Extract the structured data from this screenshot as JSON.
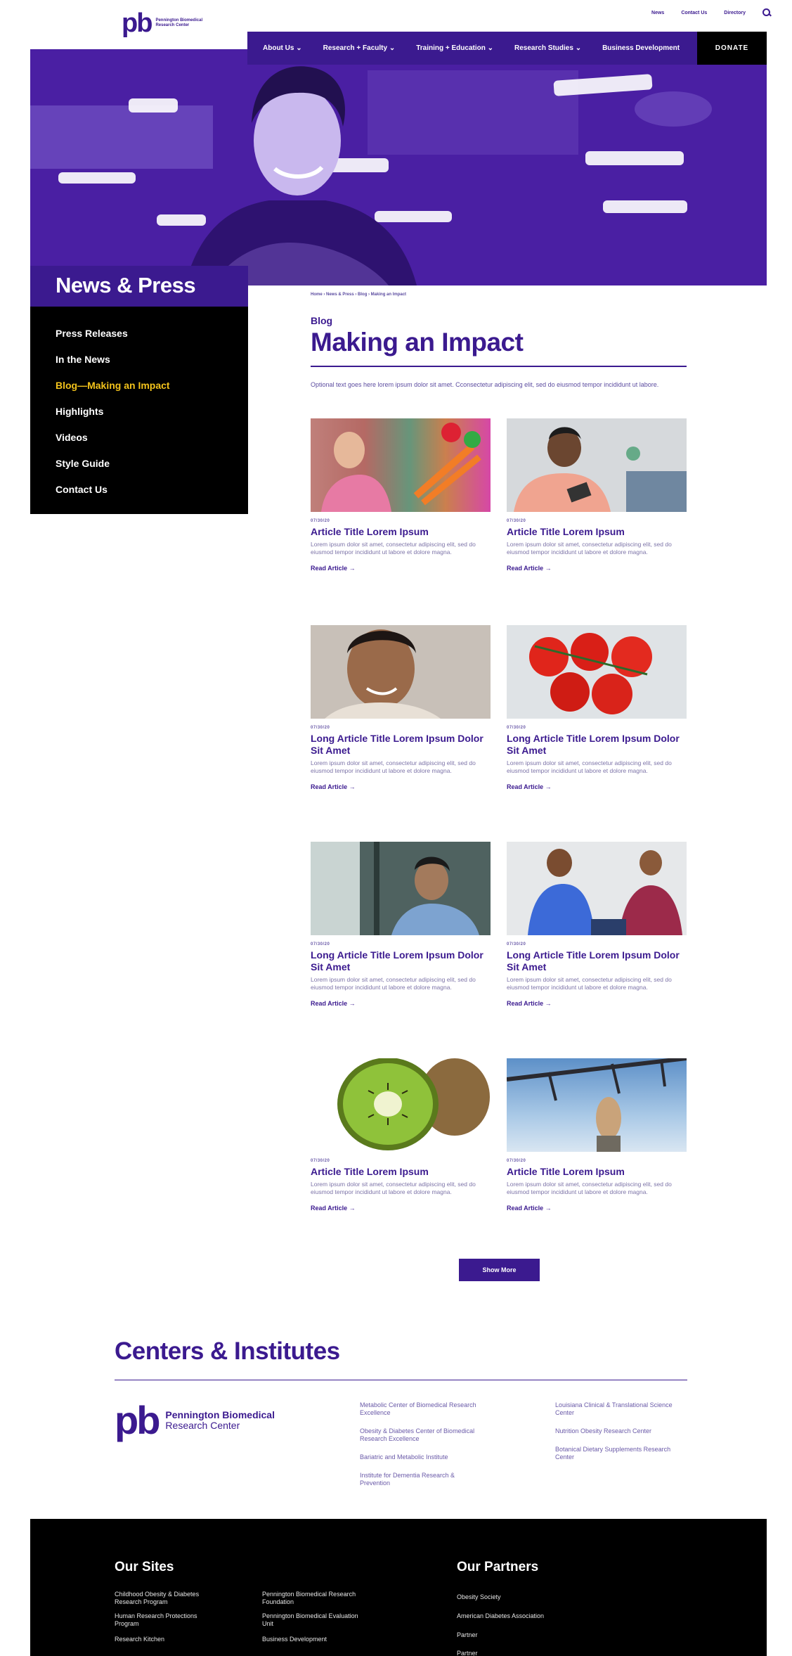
{
  "header": {
    "logo_mark": "pb",
    "logo_text": "Pennington Biomedical Research Center",
    "util_nav": [
      "News",
      "Contact Us",
      "Directory"
    ],
    "nav": [
      "About Us ⌄",
      "Research + Faculty ⌄",
      "Training + Education ⌄",
      "Research Studies ⌄",
      "Business Development"
    ],
    "donate": "DONATE"
  },
  "sidebar": {
    "title": "News & Press",
    "items": [
      "Press Releases",
      "In the News",
      "Blog—Making an Impact",
      "Highlights",
      "Videos",
      "Style Guide",
      "Contact Us"
    ],
    "active_index": 2
  },
  "main": {
    "breadcrumb": "Home › News & Press › Blog › Making an Impact",
    "eyebrow": "Blog",
    "title": "Making an Impact",
    "intro": "Optional text goes here lorem ipsum dolor sit amet. Cconsectetur adipiscing elit, sed do eiusmod tempor incididunt ut labore.",
    "cards": [
      {
        "date": "07/30/20",
        "title": "Article Title Lorem Ipsum",
        "body": "Lorem ipsum dolor sit amet, consectetur adipiscing elit, sed do eiusmod tempor incididunt ut labore et dolore magna.",
        "link": "Read Article →"
      },
      {
        "date": "07/30/20",
        "title": "Article Title Lorem Ipsum",
        "body": "Lorem ipsum dolor sit amet, consectetur adipiscing elit, sed do eiusmod tempor incididunt ut labore et dolore magna.",
        "link": "Read Article →"
      },
      {
        "date": "07/30/20",
        "title": "Long Article Title Lorem Ipsum Dolor Sit Amet",
        "body": "Lorem ipsum dolor sit amet, consectetur adipiscing elit, sed do eiusmod tempor incididunt ut labore et dolore magna.",
        "link": "Read Article →"
      },
      {
        "date": "07/30/20",
        "title": "Long Article Title Lorem Ipsum Dolor Sit Amet",
        "body": "Lorem ipsum dolor sit amet, consectetur adipiscing elit, sed do eiusmod tempor incididunt ut labore et dolore magna.",
        "link": "Read Article →"
      },
      {
        "date": "07/30/20",
        "title": "Long Article Title Lorem Ipsum Dolor Sit Amet",
        "body": "Lorem ipsum dolor sit amet, consectetur adipiscing elit, sed do eiusmod tempor incididunt ut labore et dolore magna.",
        "link": "Read Article →"
      },
      {
        "date": "07/30/20",
        "title": "Long Article Title Lorem Ipsum Dolor Sit Amet",
        "body": "Lorem ipsum dolor sit amet, consectetur adipiscing elit, sed do eiusmod tempor incididunt ut labore et dolore magna.",
        "link": "Read Article →"
      },
      {
        "date": "07/30/20",
        "title": "Article Title Lorem Ipsum",
        "body": "Lorem ipsum dolor sit amet, consectetur adipiscing elit, sed do eiusmod tempor incididunt ut labore et dolore magna.",
        "link": "Read Article →"
      },
      {
        "date": "07/30/20",
        "title": "Article Title Lorem Ipsum",
        "body": "Lorem ipsum dolor sit amet, consectetur adipiscing elit, sed do eiusmod tempor incididunt ut labore et dolore magna.",
        "link": "Read Article →"
      }
    ],
    "show_more": "Show More"
  },
  "centers": {
    "title": "Centers & Institutes",
    "logo_name": "Pennington Biomedical",
    "logo_sub": "Research Center",
    "col1": [
      "Metabolic Center of Biomedical Research Excellence",
      "Obesity & Diabetes Center of Biomedical Research Excellence",
      "Bariatric and Metabolic Institute",
      "Institute for Dementia Research & Prevention"
    ],
    "col2": [
      "Louisiana Clinical & Translational Science Center",
      "Nutrition Obesity Research Center",
      "Botanical Dietary Supplements Research Center"
    ]
  },
  "footer": {
    "our_sites": "Our Sites",
    "our_partners": "Our Partners",
    "sites_col1": [
      "Childhood Obesity & Diabetes Research Program",
      "Human Research Protections Program",
      "Research Kitchen"
    ],
    "sites_col2": [
      "Pennington Biomedical Research Foundation",
      "Pennington Biomedical Evaluation Unit",
      "Business Development"
    ],
    "partners": [
      "Obesity Society",
      "American Diabetes Association",
      "Partner",
      "Partner"
    ]
  },
  "colors": {
    "brand_purple": "#3b1a8f",
    "active_yellow": "#f2c21b",
    "black": "#000000"
  }
}
